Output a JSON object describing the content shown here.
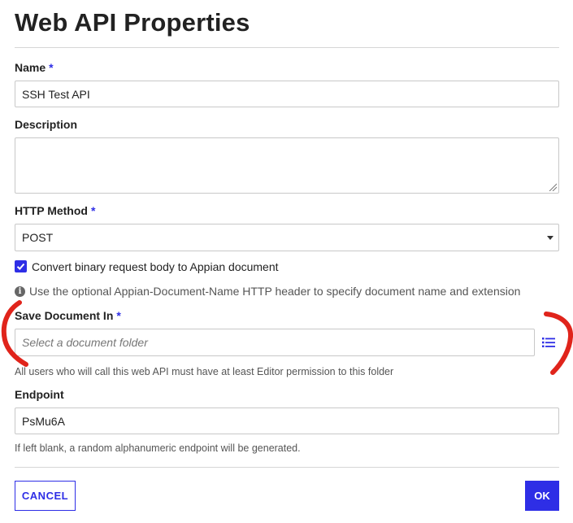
{
  "dialog": {
    "title": "Web API Properties"
  },
  "required_marker": "*",
  "fields": {
    "name": {
      "label": "Name",
      "value": "SSH Test API"
    },
    "description": {
      "label": "Description",
      "value": ""
    },
    "http_method": {
      "label": "HTTP Method",
      "value": "POST"
    },
    "convert_binary": {
      "label": "Convert binary request body to Appian document",
      "checked": true
    },
    "info_note": "Use the optional Appian-Document-Name HTTP header to specify document name and extension",
    "save_document_in": {
      "label": "Save Document In",
      "placeholder": "Select a document folder",
      "hint": "All users who will call this web API must have at least Editor permission to this folder"
    },
    "endpoint": {
      "label": "Endpoint",
      "value": "PsMu6A",
      "hint": "If left blank, a random alphanumeric endpoint will be generated."
    }
  },
  "buttons": {
    "cancel": "CANCEL",
    "ok": "OK"
  },
  "colors": {
    "accent": "#2e2ee6",
    "annotation": "#e0241b"
  }
}
